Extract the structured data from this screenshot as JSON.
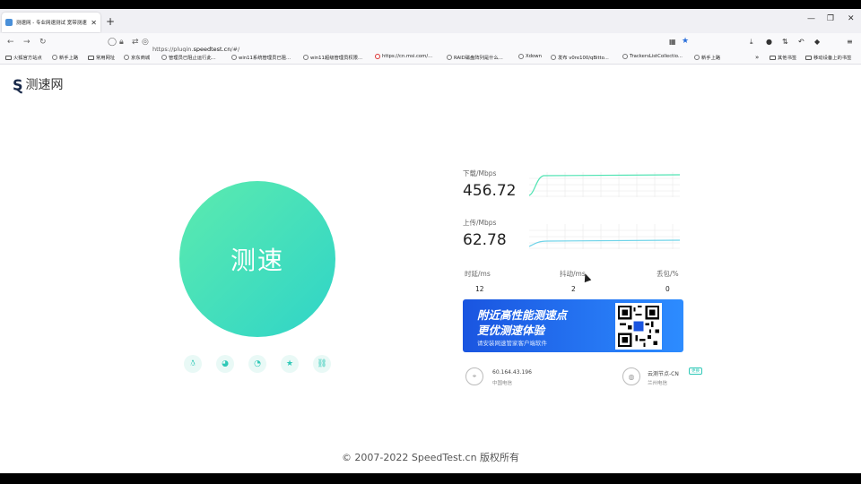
{
  "browser": {
    "tab_title": "测速网 - 专业网速测试 宽带测速",
    "tab_close": "✕",
    "new_tab": "+",
    "url_prefix": "https://plugin.",
    "url_domain": "speedtest.cn",
    "url_suffix": "/#/",
    "win_minimize": "—",
    "win_restore": "❐",
    "win_close": "✕"
  },
  "bookmarks": [
    {
      "label": "火狐官方站点"
    },
    {
      "label": "新手上路"
    },
    {
      "label": "常用网址"
    },
    {
      "label": "京东商城"
    },
    {
      "label": "管理员已阻止运行此..."
    },
    {
      "label": "win11系统管理员已阻..."
    },
    {
      "label": "win11超级管理员权限..."
    },
    {
      "label": "https://cn.msi.com/..."
    },
    {
      "label": "RAID磁盘阵列是什么..."
    },
    {
      "label": "Xdown"
    },
    {
      "label": "发布 v0re100/qBitto..."
    },
    {
      "label": "TrackersListCollectio..."
    },
    {
      "label": "新手上路"
    }
  ],
  "bookmarks_right": [
    {
      "label": "其他书签"
    },
    {
      "label": "移动设备上的书签"
    }
  ],
  "page": {
    "logo_text": "测速网",
    "speed_button": "测速",
    "download_label": "下载/Mbps",
    "download_value": "456.72",
    "upload_label": "上传/Mbps",
    "upload_value": "62.78",
    "latency_label": "时延/ms",
    "latency_value": "12",
    "jitter_label": "抖动/ms",
    "jitter_value": "2",
    "loss_label": "丢包/%",
    "loss_value": "0",
    "banner_line1": "附近高性能测速点",
    "banner_line2": "更优测速体验",
    "banner_line3": "请安装网速管家客户端软件",
    "ip": "60.164.43.196",
    "isp": "中国电信",
    "node": "云测节点-CN",
    "node_badge": "更换",
    "node_city": "兰州电信",
    "copyright": "© 2007-2022 SpeedTest.cn 版权所有"
  },
  "colors": {
    "accent": "#2fd4c8",
    "accent_start": "#5cebae",
    "banner_blue": "#1a55e0"
  }
}
